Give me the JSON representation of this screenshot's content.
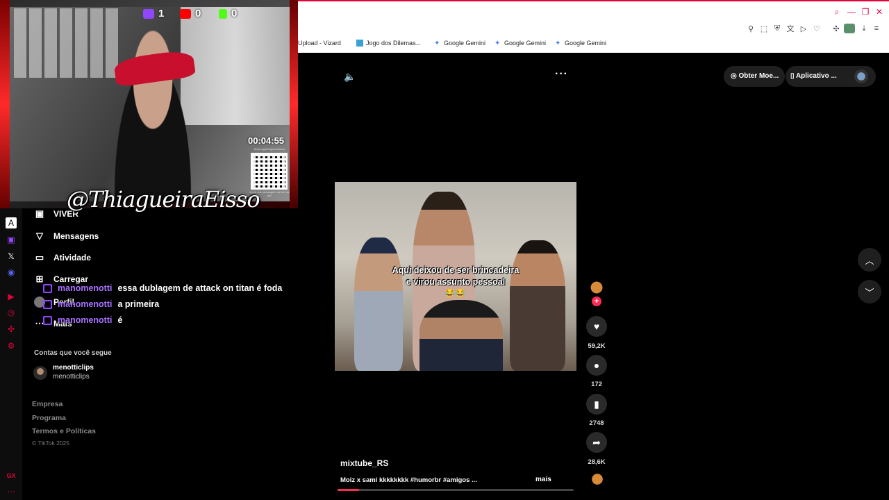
{
  "stream_overlay": {
    "counters": [
      {
        "platform": "twitch-icon",
        "value": "1",
        "color": "#9146ff"
      },
      {
        "platform": "youtube-icon",
        "value": "0",
        "color": "#ff0000"
      },
      {
        "platform": "kick-icon",
        "value": "0",
        "color": "#53fc18"
      }
    ],
    "timer": "00:04:55",
    "handle": "@ThiagueiraEisso",
    "qr_caption": "envie sua mensagem na live via pix!",
    "qr_url": "livepix.gg/thiagueiraeisso"
  },
  "browser": {
    "bookmarks": [
      "Upload - Vizard",
      "Jogo dos Dilemas...",
      "Google Gemini",
      "Google Gemini",
      "Google Gemini"
    ]
  },
  "sidebar": {
    "nav": [
      "VIVER",
      "Mensagens",
      "Atividade",
      "Carregar",
      "Perfil",
      "Mais"
    ],
    "following_title": "Contas que você segue",
    "following": [
      {
        "name": "menotticlips",
        "handle": "menotticlips"
      }
    ],
    "footer": [
      "Empresa",
      "Programa",
      "Termos e Políticas"
    ],
    "copyright": "© TikTok 2025"
  },
  "chat": [
    {
      "user": "manomenotti",
      "message": "essa dublagem de attack on titan é foda"
    },
    {
      "user": "manomenotti",
      "message": "a primeira"
    },
    {
      "user": "manomenotti",
      "message": "é"
    }
  ],
  "header": {
    "coins_label": "Obter Moe...",
    "app_label": "Aplicativo ..."
  },
  "video": {
    "caption_line1": "Aqui deixou de ser brincadeira",
    "caption_line2": "e virou assunto pessoal",
    "caption_emoji": "😂😂",
    "author": "mixtube_RS",
    "description": "Moiz x sami kkkkkkkk #humorbr #amigos ...",
    "more_label": "mais",
    "likes": "59,2K",
    "comments": "172",
    "saves": "2748",
    "shares": "28,6K",
    "progress": 0.09
  },
  "colors": {
    "accent": "#fe2c55",
    "twitch": "#9146ff",
    "opera": "#e4003a"
  }
}
